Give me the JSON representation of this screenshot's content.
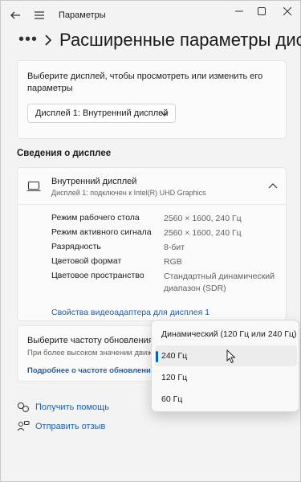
{
  "window": {
    "title": "Параметры",
    "minimize_icon": "minimize-icon",
    "maximize_icon": "maximize-icon",
    "close_icon": "close-icon"
  },
  "header": {
    "overflow_dots": "•••",
    "title": "Расширенные параметры дисплея"
  },
  "select_display": {
    "prompt": "Выберите дисплей, чтобы просмотреть или изменить его параметры",
    "selected_value": "Дисплей 1: Внутренний дисплей"
  },
  "display_info": {
    "section_title": "Сведения о дисплее",
    "device_name": "Внутренний дисплей",
    "device_sub": "Дисплей 1: подключен к Intel(R) UHD Graphics",
    "rows": [
      {
        "key": "Режим рабочего стола",
        "value": "2560 × 1600, 240 Гц"
      },
      {
        "key": "Режим активного сигнала",
        "value": "2560 × 1600, 240 Гц"
      },
      {
        "key": "Разрядность",
        "value": "8-бит"
      },
      {
        "key": "Цветовой формат",
        "value": "RGB"
      },
      {
        "key": "Цветовое пространство",
        "value": "Стандартный динамический диапазон (SDR)"
      }
    ],
    "adapter_link": "Свойства видеоадаптера для дисплея 1"
  },
  "refresh_rate": {
    "title": "Выберите частоту обновления",
    "description": "При более высоком значении движения будут более плавное, но потребление больше энергии",
    "link": "Подробнее о частоте обновления",
    "options": [
      {
        "label": "Динамический (120 Гц или 240 Гц)",
        "selected": false
      },
      {
        "label": "240 Гц",
        "selected": true
      },
      {
        "label": "120 Гц",
        "selected": false
      },
      {
        "label": "60 Гц",
        "selected": false
      }
    ]
  },
  "footer": {
    "help": "Получить помощь",
    "feedback": "Отправить отзыв"
  },
  "colors": {
    "accent": "#0067c0",
    "link": "#1a5fb4",
    "background": "#f3f3f3",
    "card": "#fbfbfb"
  }
}
